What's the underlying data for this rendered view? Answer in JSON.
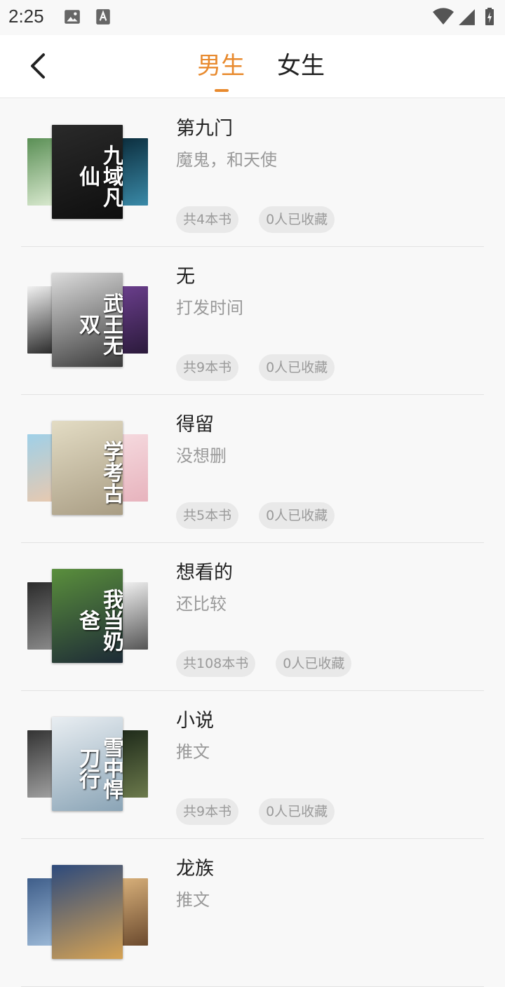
{
  "status_bar": {
    "time": "2:25",
    "icons": [
      "image-icon",
      "text-a-icon",
      "wifi-icon",
      "signal-icon",
      "battery-charging-icon"
    ]
  },
  "header": {
    "back_icon": "chevron-left-icon",
    "tabs": [
      {
        "label": "男生",
        "active": true
      },
      {
        "label": "女生",
        "active": false
      }
    ],
    "accent_color": "#e88a2e"
  },
  "booklists": [
    {
      "title": "第九门",
      "subtitle": "魔鬼，和天使",
      "book_count": "共4本书",
      "collect_count": "0人已收藏",
      "covers": {
        "main": {
          "colors": [
            "#2a2a2a",
            "#0e0e0e"
          ],
          "text": "九域凡仙"
        },
        "left": {
          "colors": [
            "#5a8f55",
            "#d9e9cf"
          ]
        },
        "right": {
          "colors": [
            "#0c2e3e",
            "#3a8aa8"
          ]
        }
      }
    },
    {
      "title": "无",
      "subtitle": "打发时间",
      "book_count": "共9本书",
      "collect_count": "0人已收藏",
      "covers": {
        "main": {
          "colors": [
            "#dcdcdc",
            "#3a3a3a"
          ],
          "text": "武王无双"
        },
        "left": {
          "colors": [
            "#f2f2f2",
            "#2a2a2a"
          ]
        },
        "right": {
          "colors": [
            "#6a3e8c",
            "#2b1a3b"
          ]
        }
      }
    },
    {
      "title": "得留",
      "subtitle": "没想删",
      "book_count": "共5本书",
      "collect_count": "0人已收藏",
      "covers": {
        "main": {
          "colors": [
            "#e3dcc4",
            "#a99d84"
          ],
          "text": "学考古"
        },
        "left": {
          "colors": [
            "#9fd0e8",
            "#e7c9b0"
          ]
        },
        "right": {
          "colors": [
            "#f5d9de",
            "#e7b3bd"
          ]
        }
      }
    },
    {
      "title": "想看的",
      "subtitle": "还比较",
      "book_count": "共108本书",
      "collect_count": "0人已收藏",
      "covers": {
        "main": {
          "colors": [
            "#5a8f3c",
            "#1d2a36"
          ],
          "text": "我当奶爸"
        },
        "left": {
          "colors": [
            "#2b2b2b",
            "#8a8a8a"
          ]
        },
        "right": {
          "colors": [
            "#f1f1f1",
            "#555555"
          ]
        }
      }
    },
    {
      "title": "小说",
      "subtitle": "推文",
      "book_count": "共9本书",
      "collect_count": "0人已收藏",
      "covers": {
        "main": {
          "colors": [
            "#e9eef2",
            "#8aa4b6"
          ],
          "text": "雪中悍刀行"
        },
        "left": {
          "colors": [
            "#333333",
            "#a0a0a0"
          ]
        },
        "right": {
          "colors": [
            "#1e2a1a",
            "#6c7a4c"
          ]
        }
      }
    },
    {
      "title": "龙族",
      "subtitle": "推文",
      "book_count": "",
      "collect_count": "",
      "covers": {
        "main": {
          "colors": [
            "#2d4a7c",
            "#d6a354"
          ],
          "text": ""
        },
        "left": {
          "colors": [
            "#3f5e8a",
            "#9bb8d6"
          ]
        },
        "right": {
          "colors": [
            "#d8b07a",
            "#6b4a2e"
          ]
        }
      }
    }
  ]
}
